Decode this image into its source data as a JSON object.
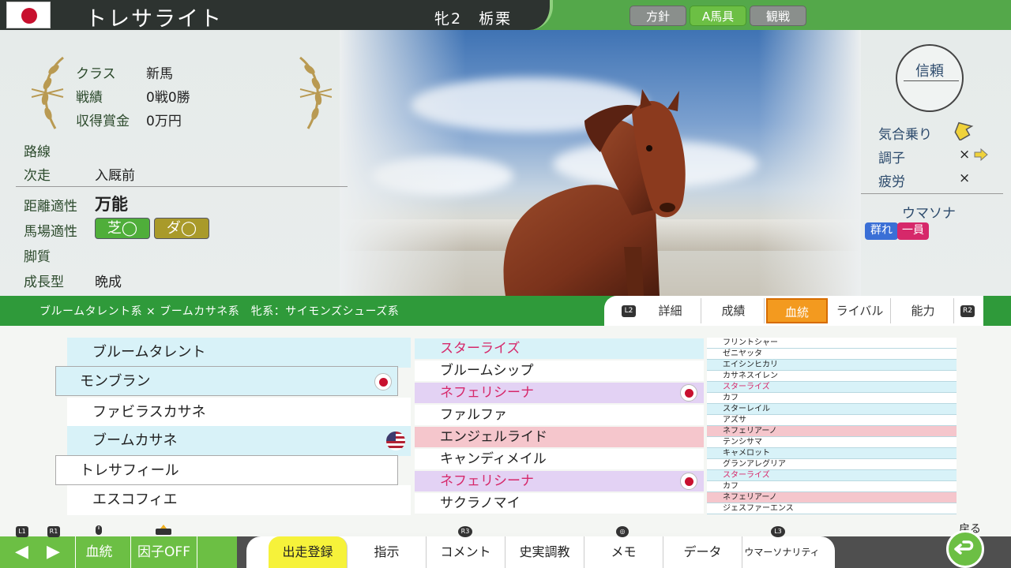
{
  "header": {
    "horse_name": "トレサライト",
    "sex_age_color": "牝2　栃栗",
    "tabs": [
      "方針",
      "A馬具",
      "観戦"
    ],
    "active_tab": "A馬具"
  },
  "profile": {
    "class_label": "クラス",
    "class_value": "新馬",
    "record_label": "戦績",
    "record_value": "0戦0勝",
    "earnings_label": "収得賞金",
    "earnings_value": "0万円",
    "route_label": "路線",
    "route_value": "",
    "next_label": "次走",
    "next_value": "入厩前",
    "distance_label": "距離適性",
    "distance_value": "万能",
    "surface_label": "馬場適性",
    "turf": "芝◯",
    "dirt": "ダ◯",
    "style_label": "脚質",
    "style_value": "",
    "growth_label": "成長型",
    "growth_value": "晩成"
  },
  "status": {
    "trust_label": "信頼",
    "spirit_label": "気合乗り",
    "condition_label": "調子",
    "condition_value": "×",
    "fatigue_label": "疲労",
    "fatigue_value": "×",
    "umasona_label": "ウマソナ",
    "badge_a": "群れ",
    "badge_b": "一員"
  },
  "midbar": {
    "lineage": "ブルームタレント系 × ブームカサネ系　牝系：サイモンズシューズ系",
    "tabs": [
      "詳細",
      "成績",
      "血統",
      "ライバル",
      "能力"
    ],
    "active_tab": "血統",
    "l2": "L2",
    "r2": "R2"
  },
  "pedigree": {
    "gen1": [
      "ブルームタレント",
      "モンブラン",
      "ファビラスカサネ",
      "ブームカサネ",
      "トレサフィール",
      "エスコフィエ"
    ],
    "gen2": [
      "スターライズ",
      "ブルームシップ",
      "ネフェリシーナ",
      "ファルファ",
      "エンジェルライド",
      "キャンディメイル",
      "ネフェリシーナ",
      "サクラノマイ"
    ],
    "gen3": [
      "フリントシャー",
      "ゼニヤッタ",
      "エイシンヒカリ",
      "カサネスイレン",
      "スターライズ",
      "カフ",
      "スターレイル",
      "アズサ",
      "ネフェリアーノ",
      "テンシサマ",
      "キャメロット",
      "グランアレグリア",
      "スターライズ",
      "カフ",
      "ネフェリアーノ",
      "ジェスファーエンス"
    ]
  },
  "bottom": {
    "left": [
      "◀",
      "▶",
      "血統",
      "因子OFF"
    ],
    "hints_left": [
      "L1",
      "R1"
    ],
    "menu": [
      "出走登録",
      "指示",
      "コメント",
      "史実調教",
      "メモ",
      "データ",
      "ウマーソナリティ"
    ],
    "active_menu": "出走登録",
    "hints_menu": [
      "R3",
      "◎",
      "L3"
    ],
    "back_label": "戻る"
  },
  "colors": {
    "accent_green": "#2f9a3a",
    "active_orange": "#f39a1f",
    "highlight_yellow": "#f6f23a"
  }
}
